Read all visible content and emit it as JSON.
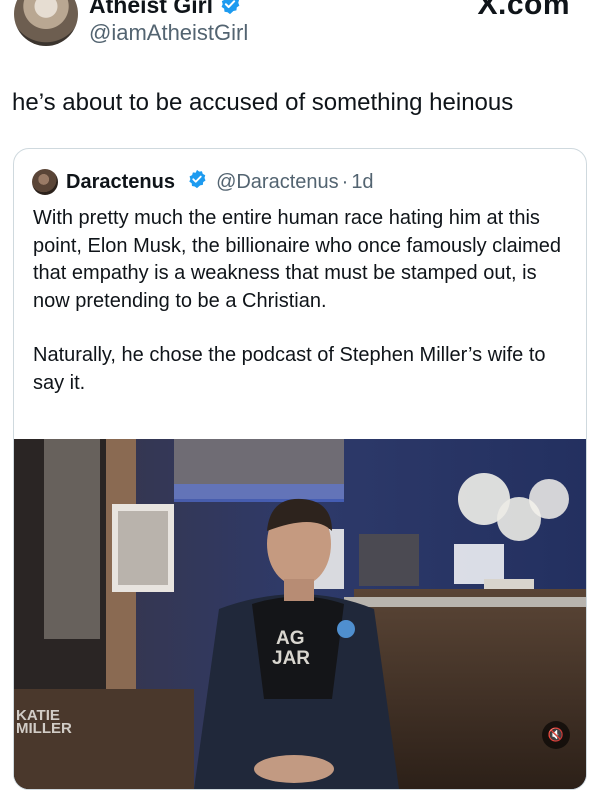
{
  "author": {
    "display_name": "Atheist Girl",
    "handle": "@iamAtheistGirl",
    "verified": true,
    "avatar": "avatar-photo"
  },
  "brand": {
    "logo_text": "X.com"
  },
  "tweet": {
    "text": "he’s about to be accused of something heinous"
  },
  "quoted_tweet": {
    "author_name": "Daractenus",
    "handle": "@Daractenus",
    "separator": "·",
    "time": "1d",
    "verified": true,
    "paragraphs": [
      "With pretty much the entire human race hating him at this point, Elon Musk, the billionaire who once famously claimed that empathy is a weakness that must be stamped out, is now pretending to be a Christian.",
      "Naturally, he chose the podcast of Stephen Miller’s wife to say it."
    ],
    "media": {
      "watermark": "KATIE\nMILLER",
      "mute_icon": "speaker-muted-icon",
      "shirt_text": "AG\nJAR"
    }
  },
  "colors": {
    "verified": "#1d9bf0",
    "secondary_text": "#536471",
    "border": "#cfd9de"
  }
}
